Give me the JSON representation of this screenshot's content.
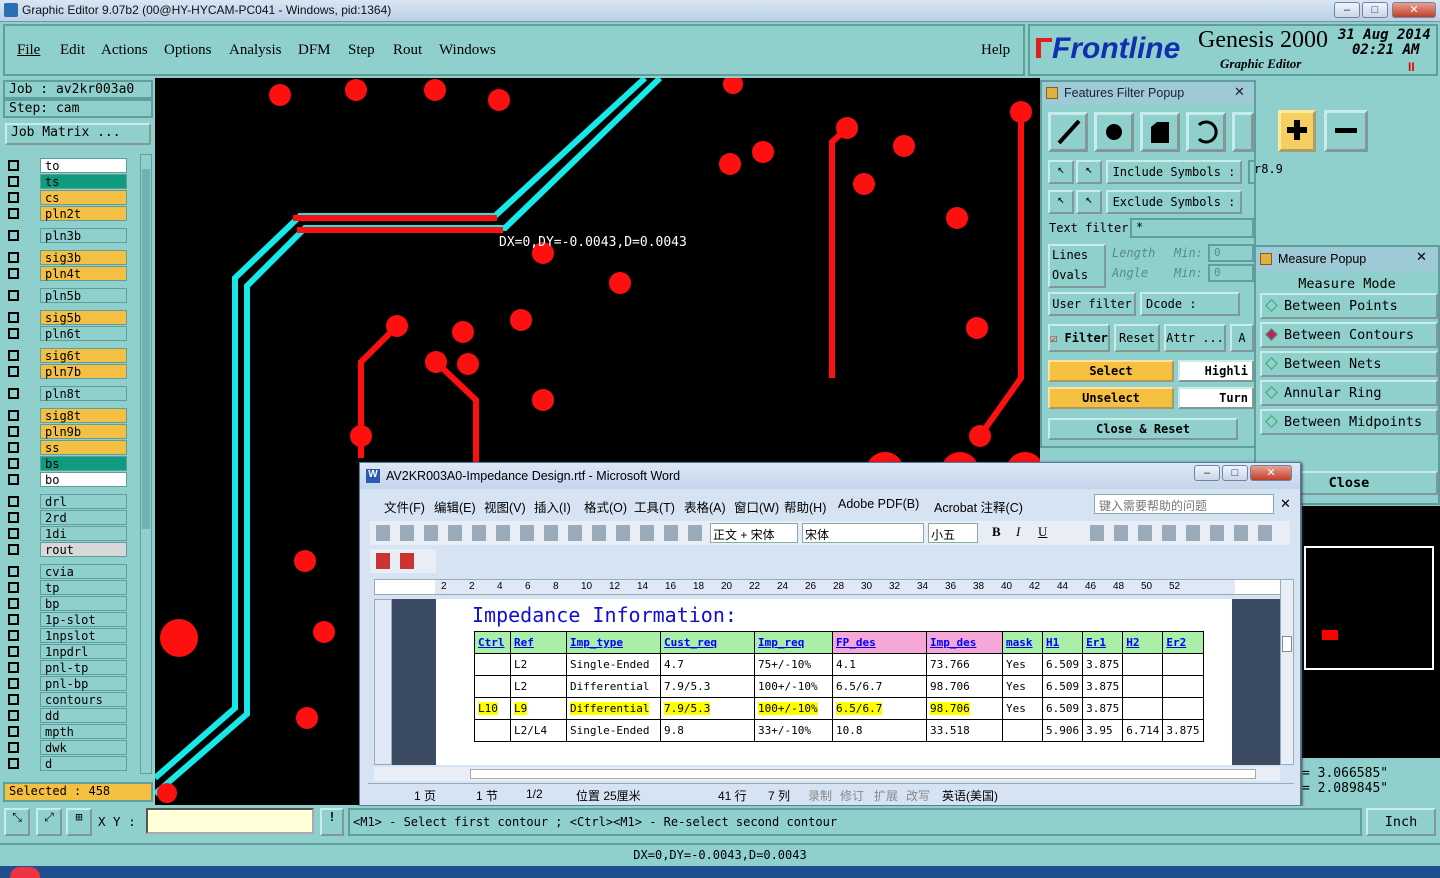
{
  "window": {
    "title": "Graphic Editor 9.07b2 (00@HY-HYCAM-PC041 - Windows, pid:1364)"
  },
  "menu": {
    "items": [
      "File",
      "Edit",
      "Actions",
      "Options",
      "Analysis",
      "DFM",
      "Step",
      "Rout",
      "Windows"
    ],
    "help": "Help"
  },
  "brand": {
    "logo": "Frontline",
    "product": "Genesis 2000",
    "sub": "Graphic Editor",
    "date": "31 Aug 2014",
    "time": "02:21 AM",
    "pause": "II"
  },
  "job": {
    "job_label": "Job : av2kr003a0",
    "step_label": "Step: cam",
    "matrix_btn": "Job Matrix ..."
  },
  "layers": [
    {
      "name": "to",
      "color": "#ffffff"
    },
    {
      "name": "ts",
      "color": "#109a7e"
    },
    {
      "name": "cs",
      "color": "#f3c043"
    },
    {
      "name": "pln2t",
      "color": "#f3c043"
    },
    {
      "name": "pln3b",
      "color": "#8fd0cd"
    },
    {
      "name": "sig3b",
      "color": "#f3c043"
    },
    {
      "name": "pln4t",
      "color": "#f3c043"
    },
    {
      "name": "pln5b",
      "color": "#8fd0cd"
    },
    {
      "name": "sig5b",
      "color": "#f3c043"
    },
    {
      "name": "pln6t",
      "color": "#8fd0cd"
    },
    {
      "name": "sig6t",
      "color": "#f3c043"
    },
    {
      "name": "pln7b",
      "color": "#f3c043"
    },
    {
      "name": "pln8t",
      "color": "#8fd0cd"
    },
    {
      "name": "sig8t",
      "color": "#f3c043"
    },
    {
      "name": "pln9b",
      "color": "#f3c043"
    },
    {
      "name": "ss",
      "color": "#f3c043"
    },
    {
      "name": "bs",
      "color": "#109a7e"
    },
    {
      "name": "bo",
      "color": "#ffffff"
    },
    {
      "name": "drl",
      "color": "#8fd0cd"
    },
    {
      "name": "2rd",
      "color": "#8fd0cd"
    },
    {
      "name": "1di",
      "color": "#8fd0cd"
    },
    {
      "name": "rout",
      "color": "#d8d8d8"
    },
    {
      "name": "cvia",
      "color": "#8fd0cd"
    },
    {
      "name": "tp",
      "color": "#8fd0cd"
    },
    {
      "name": "bp",
      "color": "#8fd0cd"
    },
    {
      "name": "1p-slot",
      "color": "#8fd0cd"
    },
    {
      "name": "1npslot",
      "color": "#8fd0cd"
    },
    {
      "name": "1npdrl",
      "color": "#8fd0cd"
    },
    {
      "name": "pnl-tp",
      "color": "#8fd0cd"
    },
    {
      "name": "pnl-bp",
      "color": "#8fd0cd"
    },
    {
      "name": "contours",
      "color": "#8fd0cd"
    },
    {
      "name": "dd",
      "color": "#8fd0cd"
    },
    {
      "name": "mpth",
      "color": "#8fd0cd"
    },
    {
      "name": "dwk",
      "color": "#8fd0cd"
    },
    {
      "name": "d",
      "color": "#8fd0cd"
    }
  ],
  "selected": "Selected : 458",
  "canvas": {
    "measure_text": "DX=0,DY=-0.0043,D=0.0043"
  },
  "filter": {
    "title": "Features Filter Popup",
    "include_label": "Include Symbols :",
    "include_value": "r8.9",
    "exclude_label": "Exclude Symbols :",
    "exclude_value": "",
    "text_filter_label": "Text filter",
    "text_filter_value": "*",
    "lines": "Lines",
    "ovals": "Ovals",
    "length": "Length",
    "angle": "Angle",
    "min": "Min:",
    "min_value": "0",
    "user_filter": "User filter ...",
    "dcode": "Dcode :",
    "filter_btn": "Filter",
    "reset": "Reset",
    "attr": "Attr ...",
    "a": "A",
    "select": "Select",
    "unselect": "Unselect",
    "highli": "Highli",
    "turn": "Turn",
    "close_reset": "Close & Reset"
  },
  "measure": {
    "title": "Measure Popup",
    "mode": "Measure Mode",
    "options": [
      "Between Points",
      "Between Contours",
      "Between Nets",
      "Annular Ring",
      "Between Midpoints"
    ],
    "close": "Close",
    "val1": "= 3.066585\"",
    "val2": "= 2.089845\""
  },
  "word": {
    "title": "AV2KR003A0-Impedance Design.rtf - Microsoft Word",
    "menu": [
      "文件(F)",
      "编辑(E)",
      "视图(V)",
      "插入(I)",
      "格式(O)",
      "工具(T)",
      "表格(A)",
      "窗口(W)",
      "帮助(H)",
      "Adobe PDF(B)",
      "Acrobat 注释(C)"
    ],
    "help_placeholder": "键入需要帮助的问题",
    "style": "正文 + 宋体",
    "font": "宋体",
    "size": "小五",
    "heading": "Impedance Information:",
    "headers": [
      "Ctrl",
      "Ref",
      "Imp_type",
      "Cust_req",
      "Imp_req",
      "FP_des",
      "Imp_des",
      "mask",
      "H1",
      "Er1",
      "H2",
      "Er2"
    ],
    "rows": [
      [
        "",
        "L2",
        "Single-Ended",
        "4.7",
        "75+/-10%",
        "4.1",
        "73.766",
        "Yes",
        "6.509",
        "3.875",
        "",
        ""
      ],
      [
        "",
        "L2",
        "Differential",
        "7.9/5.3",
        "100+/-10%",
        "6.5/6.7",
        "98.706",
        "Yes",
        "6.509",
        "3.875",
        "",
        ""
      ],
      [
        "L10",
        "L9",
        "Differential",
        "7.9/5.3",
        "100+/-10%",
        "6.5/6.7",
        "98.706",
        "Yes",
        "6.509",
        "3.875",
        "",
        ""
      ],
      [
        "",
        "L2/L4",
        "Single-Ended",
        "9.8",
        "33+/-10%",
        "10.8",
        "33.518",
        "",
        "5.906",
        "3.95",
        "6.714",
        "3.875"
      ]
    ],
    "ruler": [
      "2",
      "2",
      "4",
      "6",
      "8",
      "10",
      "12",
      "14",
      "16",
      "18",
      "20",
      "22",
      "24",
      "26",
      "28",
      "30",
      "32",
      "34",
      "36",
      "38",
      "40",
      "42",
      "44",
      "46",
      "48",
      "50",
      "52"
    ],
    "status": {
      "page": "1 页",
      "section": "1 节",
      "pages": "1/2",
      "position": "位置 25厘米",
      "line": "41 行",
      "col": "7 列",
      "rec": "录制",
      "rev": "修订",
      "ext": "扩展",
      "ovr": "改写",
      "lang": "英语(美国)"
    }
  },
  "bottom": {
    "xy": "X Y :",
    "prompt": "<M1> - Select first contour ; <Ctrl><M1> - Re-select second contour",
    "units": "Inch",
    "status": "DX=0,DY=-0.0043,D=0.0043"
  }
}
